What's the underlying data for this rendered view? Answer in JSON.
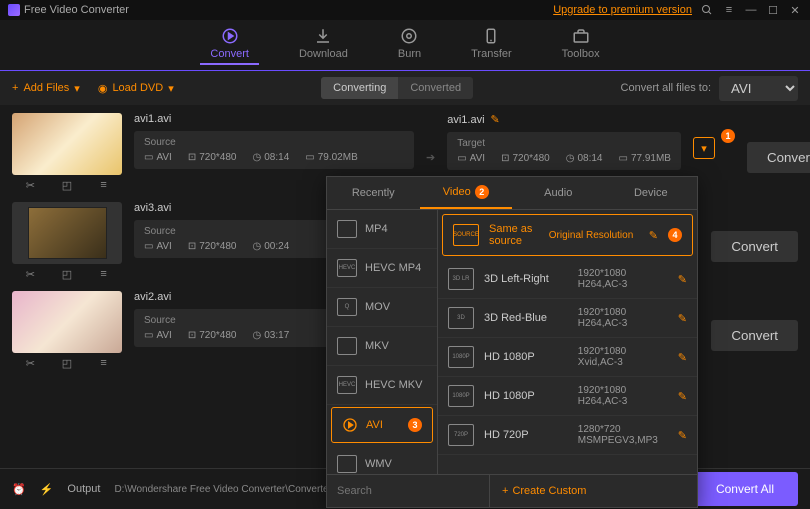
{
  "app": {
    "title": "Free Video Converter",
    "upgrade": "Upgrade to premium version"
  },
  "nav": {
    "convert": "Convert",
    "download": "Download",
    "burn": "Burn",
    "transfer": "Transfer",
    "toolbox": "Toolbox"
  },
  "toolbar": {
    "add_files": "Add Files",
    "load_dvd": "Load DVD",
    "tab_converting": "Converting",
    "tab_converted": "Converted",
    "convert_all_to": "Convert all files to:",
    "convert_all_value": "AVI"
  },
  "files": [
    {
      "name": "avi1.avi",
      "source_label": "Source",
      "format": "AVI",
      "resolution": "720*480",
      "duration": "08:14",
      "size": "79.02MB",
      "target_name": "avi1.avi",
      "target_label": "Target",
      "t_format": "AVI",
      "t_resolution": "720*480",
      "t_duration": "08:14",
      "t_size": "77.91MB",
      "convert": "Convert"
    },
    {
      "name": "avi3.avi",
      "source_label": "Source",
      "format": "AVI",
      "resolution": "720*480",
      "duration": "00:24",
      "size": "",
      "convert": "Convert"
    },
    {
      "name": "avi2.avi",
      "source_label": "Source",
      "format": "AVI",
      "resolution": "720*480",
      "duration": "03:17",
      "size": "",
      "convert": "Convert"
    }
  ],
  "dropdown": {
    "tabs": {
      "recently": "Recently",
      "video": "Video",
      "audio": "Audio",
      "device": "Device"
    },
    "formats": [
      "MP4",
      "HEVC MP4",
      "MOV",
      "MKV",
      "HEVC MKV",
      "AVI",
      "WMV"
    ],
    "options": [
      {
        "name": "Same as source",
        "res": "Original Resolution",
        "codec": ""
      },
      {
        "name": "3D Left-Right",
        "res": "1920*1080",
        "codec": "H264,AC-3"
      },
      {
        "name": "3D Red-Blue",
        "res": "1920*1080",
        "codec": "H264,AC-3"
      },
      {
        "name": "HD 1080P",
        "res": "1920*1080",
        "codec": "Xvid,AC-3"
      },
      {
        "name": "HD 1080P",
        "res": "1920*1080",
        "codec": "H264,AC-3"
      },
      {
        "name": "HD 720P",
        "res": "1280*720",
        "codec": "MSMPEGV3,MP3"
      }
    ],
    "search_placeholder": "Search",
    "create_custom": "Create Custom"
  },
  "footer": {
    "output_label": "Output",
    "output_path": "D:\\Wondershare Free Video Converter\\Converted\\",
    "convert_all": "Convert All"
  },
  "badges": {
    "one": "1",
    "two": "2",
    "three": "3",
    "four": "4"
  }
}
